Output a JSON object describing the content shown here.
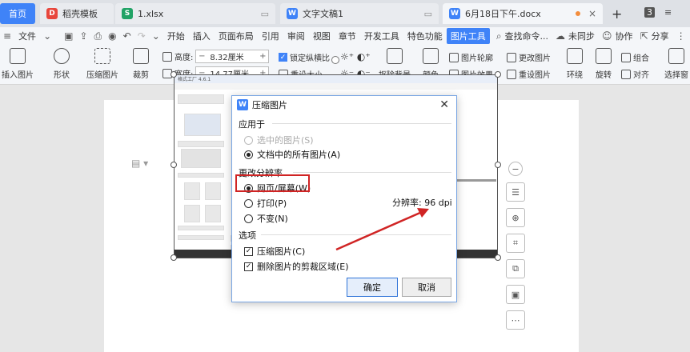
{
  "tabs": {
    "home": "首页",
    "daoke": "稻壳模板",
    "xlsx": "1.xlsx",
    "doc1": "文字文稿1",
    "active": "6月18日下午.docx"
  },
  "tabbar_right": {
    "badge": "3"
  },
  "menubar": {
    "file": "文件",
    "items": [
      "开始",
      "插入",
      "页面布局",
      "引用",
      "审阅",
      "视图",
      "章节",
      "开发工具",
      "特色功能"
    ],
    "picture_tools": "图片工具",
    "search": "查找命令...",
    "sync": "未同步",
    "collab": "协作",
    "share": "分享"
  },
  "ribbon": {
    "insert_picture": "插入图片",
    "shape": "形状",
    "compress": "压缩图片",
    "crop": "裁剪",
    "height_label": "高度:",
    "height_value": "8.32厘米",
    "width_label": "宽度:",
    "width_value": "14.77厘米",
    "lock_ratio": "锁定纵横比",
    "reset_size": "重设大小",
    "remove_bg": "抠除背景",
    "color": "颜色",
    "outline": "图片轮廓",
    "effect": "图片效果",
    "change_pic": "更改图片",
    "reset_pic": "重设图片",
    "wrap": "环绕",
    "rotate": "旋转",
    "group": "组合",
    "align": "对齐",
    "select_pane": "选择窗"
  },
  "dialog": {
    "title": "压缩图片",
    "apply_to": "应用于",
    "selected_pics": "选中的图片(S)",
    "all_pics": "文档中的所有图片(A)",
    "change_res": "更改分辨率",
    "web_screen": "网页/屏幕(W)",
    "print": "打印(P)",
    "unchanged": "不变(N)",
    "resolution_label": "分辨率:",
    "resolution_value": "96 dpi",
    "options": "选项",
    "compress_pics": "压缩图片(C)",
    "delete_crop": "删除图片的剪裁区域(E)",
    "ok": "确定",
    "cancel": "取消"
  },
  "inner_shot": {
    "title": "格式工厂 4.6.1"
  },
  "colors": {
    "accent": "#3f83f8",
    "highlight": "#d02424"
  }
}
